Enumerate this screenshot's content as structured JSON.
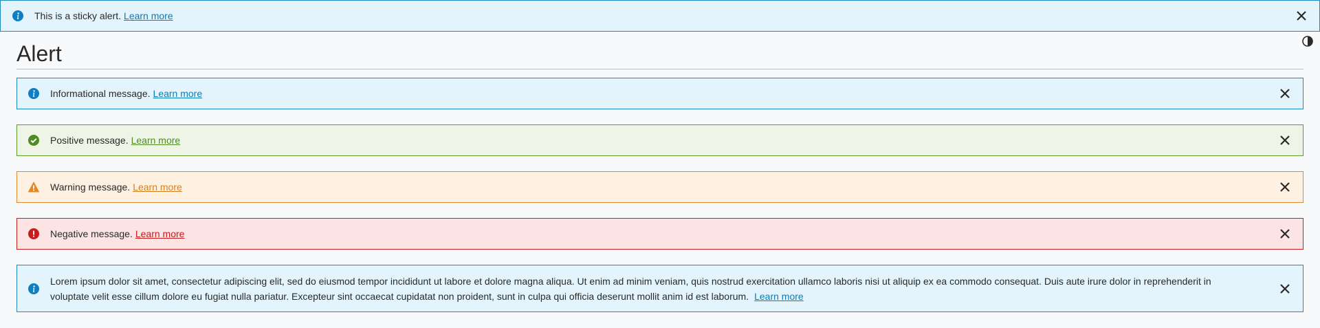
{
  "sticky_alert": {
    "message": "This is a sticky alert.",
    "link": "Learn more",
    "icon": "info-icon",
    "color": "#0e7fc0"
  },
  "page": {
    "title": "Alert",
    "contrast_icon": "contrast-toggle-icon"
  },
  "alerts": [
    {
      "variant": "info",
      "icon": "info-icon",
      "message": "Informational message.",
      "link": "Learn more",
      "icon_color": "#0e7fc0"
    },
    {
      "variant": "positive",
      "icon": "check-circle-icon",
      "message": "Positive message.",
      "link": "Learn more",
      "icon_color": "#4f8b22"
    },
    {
      "variant": "warning",
      "icon": "warning-triangle-icon",
      "message": "Warning message.",
      "link": "Learn more",
      "icon_color": "#e0892a"
    },
    {
      "variant": "negative",
      "icon": "error-circle-icon",
      "message": "Negative message.",
      "link": "Learn more",
      "icon_color": "#c81b1b"
    },
    {
      "variant": "info",
      "icon": "info-icon",
      "message": "Lorem ipsum dolor sit amet, consectetur adipiscing elit, sed do eiusmod tempor incididunt ut labore et dolore magna aliqua. Ut enim ad minim veniam, quis nostrud exercitation ullamco laboris nisi ut aliquip ex ea commodo consequat. Duis aute irure dolor in reprehenderit in voluptate velit esse cillum dolore eu fugiat nulla pariatur. Excepteur sint occaecat cupidatat non proident, sunt in culpa qui officia deserunt mollit anim id est laborum.",
      "link": "Learn more",
      "icon_color": "#0e7fc0"
    }
  ]
}
